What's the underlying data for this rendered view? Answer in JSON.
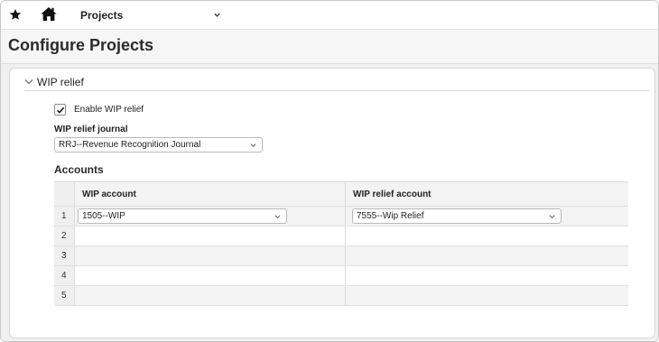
{
  "nav": {
    "module": "Projects"
  },
  "header": {
    "title": "Configure Projects"
  },
  "section": {
    "title": "WIP relief",
    "enable_label": "Enable WIP relief",
    "enable_checked": true,
    "journal_label": "WIP relief journal",
    "journal_value": "RRJ--Revenue Recognition Journal",
    "accounts_heading": "Accounts"
  },
  "grid": {
    "columns": [
      "WIP account",
      "WIP relief account"
    ],
    "rows": [
      {
        "num": "1",
        "wip": "1505--WIP",
        "relief": "7555--Wip Relief"
      },
      {
        "num": "2",
        "wip": "",
        "relief": ""
      },
      {
        "num": "3",
        "wip": "",
        "relief": ""
      },
      {
        "num": "4",
        "wip": "",
        "relief": ""
      },
      {
        "num": "5",
        "wip": "",
        "relief": ""
      }
    ]
  },
  "icons": {
    "favorite": "star-icon",
    "home": "home-icon",
    "dropdown": "chevron-down-icon",
    "collapse": "chevron-down-icon",
    "checkbox": "check-icon"
  },
  "colors": {
    "header_bg": "#f6f6f6",
    "panel_border": "#d6d6d6",
    "row_alt": "#f3f3f3"
  }
}
